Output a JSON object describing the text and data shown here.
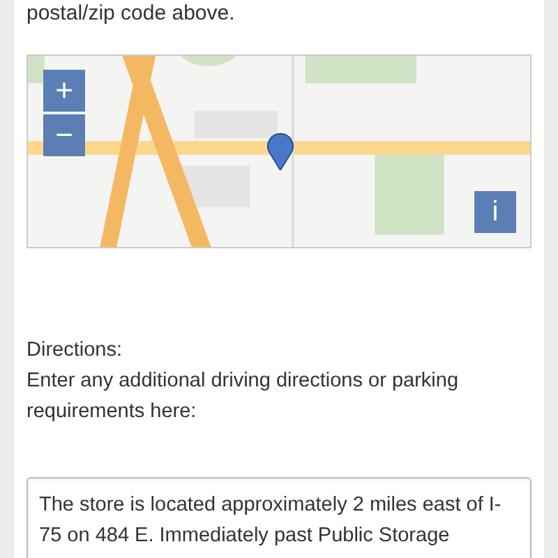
{
  "intro_text": "postal/zip code above.",
  "map": {
    "kind": "picture",
    "zoom_in": "+",
    "zoom_out": "−",
    "info": "i"
  },
  "directions": {
    "label": "Directions:",
    "help": "Enter any additional driving directions or parking requirements here:",
    "value": "The store is located approximately 2 miles east of I-75 on 484 E. Immediately past Public Storage"
  }
}
